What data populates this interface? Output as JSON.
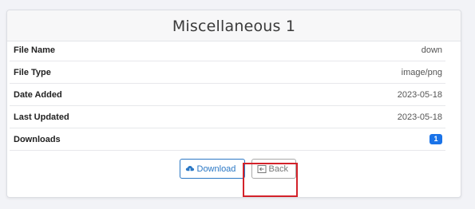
{
  "card": {
    "title": "Miscellaneous 1"
  },
  "details": [
    {
      "label": "File Name",
      "value": "down"
    },
    {
      "label": "File Type",
      "value": "image/png"
    },
    {
      "label": "Date Added",
      "value": "2023-05-18"
    },
    {
      "label": "Last Updated",
      "value": "2023-05-18"
    },
    {
      "label": "Downloads",
      "value": "1"
    }
  ],
  "actions": {
    "download_label": "Download",
    "back_label": "Back"
  },
  "colors": {
    "accent": "#2b78c5",
    "badge": "#1a73e8",
    "highlight": "#d3222a"
  },
  "icons": {
    "download": "cloud-download-icon",
    "back": "back-arrow-icon"
  }
}
